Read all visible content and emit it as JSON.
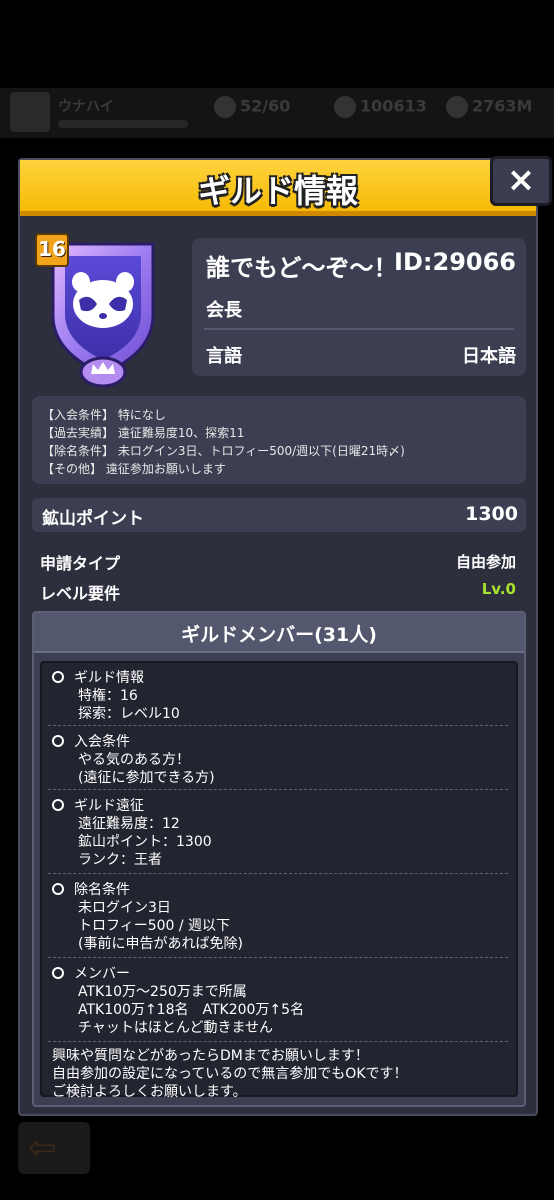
{
  "background": {
    "player_name": "ウナハイ",
    "stamina": "52/60",
    "gold": "100613",
    "gems": "2763M"
  },
  "modal": {
    "title": "ギルド情報",
    "close_icon": "×"
  },
  "guild": {
    "level": "16",
    "name": "誰でもど〜ぞ〜！",
    "id": "ID:29066",
    "leader_label": "会長",
    "language_label": "言語",
    "language_value": "日本語",
    "emblem_icon": "raccoon-emblem-icon"
  },
  "description": {
    "lines": [
      "【入会条件】 特になし",
      "【過去実績】 遠征難易度10、探索11",
      "【除名条件】 未ログイン3日、トロフィー500/週以下(日曜21時〆)",
      "【その他】 遠征参加お願いします"
    ]
  },
  "mine_points": {
    "label": "鉱山ポイント",
    "value": "1300"
  },
  "apply_type": {
    "label": "申請タイプ",
    "value": "自由参加"
  },
  "level_req": {
    "label": "レベル要件",
    "value": "Lv.0"
  },
  "members": {
    "title": "ギルドメンバー(31人)",
    "sections": [
      {
        "title": "ギルド情報",
        "lines": [
          "特権：16",
          "探索：レベル10"
        ]
      },
      {
        "title": "入会条件",
        "lines": [
          "やる気のある方！",
          "(遠征に参加できる方)"
        ]
      },
      {
        "title": "ギルド遠征",
        "lines": [
          "遠征難易度：12",
          "鉱山ポイント：1300",
          "ランク：王者"
        ]
      },
      {
        "title": "除名条件",
        "lines": [
          "未ログイン3日",
          "トロフィー500 / 週以下",
          "(事前に申告があれば免除)"
        ]
      },
      {
        "title": "メンバー",
        "lines": [
          "ATK10万〜250万まで所属",
          "ATK100万↑18名　ATK200万↑5名",
          "チャットはほとんど動きません"
        ]
      }
    ],
    "footer_lines": [
      "興味や質問などがあったらDMまでお願いします！",
      "自由参加の設定になっているので無言参加でもOKです！",
      "ご検討よろしくお願いします。"
    ]
  },
  "colors": {
    "header_yellow": "#f5b800",
    "panel": "#3c3f51",
    "modal_bg": "#2d2f3d",
    "level_green": "#a6e22e",
    "badge_orange": "#f2a31c"
  }
}
